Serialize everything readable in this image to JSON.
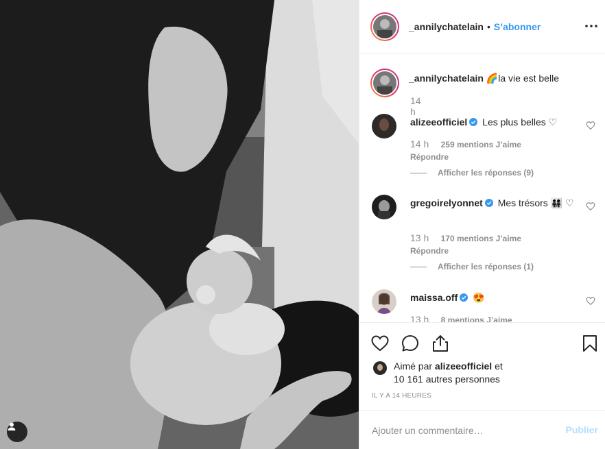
{
  "post": {
    "author": "_annilychatelain",
    "dot": "•",
    "follow_label": "S’abonner",
    "caption_text": "🌈la vie est belle",
    "caption_time": "14 h"
  },
  "comments": [
    {
      "user": "alizeeofficiel",
      "text": "Les plus belles ♡",
      "time": "14 h",
      "likes": "259 mentions J’aime",
      "reply": "Répondre",
      "view_replies": "Afficher les réponses (9)"
    },
    {
      "user": "gregoirelyonnet",
      "text": "Mes trésors 👨‍👩‍👧‍👧 ♡",
      "time": "13 h",
      "likes": "170 mentions J’aime",
      "reply": "Répondre",
      "view_replies": "Afficher les réponses (1)"
    },
    {
      "user": "maissa.off",
      "text": "😍",
      "time": "13 h",
      "likes": "8 mentions J’aime"
    }
  ],
  "likes": {
    "prefix": "Aimé par",
    "user": "alizeeofficiel",
    "suffix": "et",
    "others": "10 161 autres personnes"
  },
  "posted_ago": "IL Y A 14 HEURES",
  "add_comment": {
    "placeholder": "Ajouter un commentaire…",
    "publish": "Publier"
  },
  "colors": {
    "link_blue": "#3897f0",
    "muted": "#8e8e8e",
    "publish_disabled": "#b2dffc",
    "text": "#262626"
  },
  "icons": [
    "more-options-icon",
    "heart-icon",
    "comment-icon",
    "share-icon",
    "bookmark-icon",
    "verified-badge-icon",
    "user-tags-icon"
  ]
}
